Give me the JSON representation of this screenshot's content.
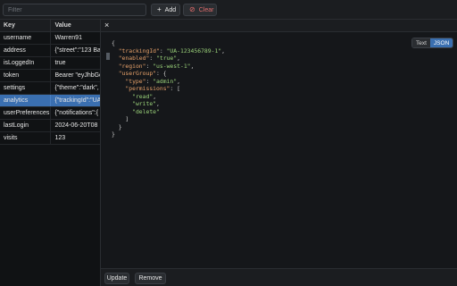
{
  "toolbar": {
    "filter_placeholder": "Filter",
    "add_label": "Add",
    "add_icon": "plus-icon",
    "clear_label": "Clear",
    "clear_icon": "ban-icon"
  },
  "table": {
    "headers": {
      "key": "Key",
      "value": "Value"
    },
    "rows": [
      {
        "key": "username",
        "value": "Warren91"
      },
      {
        "key": "address",
        "value": "{\"street\":\"123 Ba"
      },
      {
        "key": "isLoggedIn",
        "value": "true"
      },
      {
        "key": "token",
        "value": "Bearer \"eyJhbGc"
      },
      {
        "key": "settings",
        "value": "{\"theme\":\"dark\","
      },
      {
        "key": "analytics",
        "value": "{\"trackingId\":\"UA"
      },
      {
        "key": "userPreferences",
        "value": "{\"notifications\":{"
      },
      {
        "key": "lastLogin",
        "value": "2024-06-20T08"
      },
      {
        "key": "visits",
        "value": "123"
      }
    ],
    "selected_row": 5
  },
  "detail": {
    "close_icon": "close-icon",
    "view_modes": {
      "text": "Text",
      "json": "JSON",
      "active": "JSON"
    },
    "update_label": "Update",
    "remove_label": "Remove"
  },
  "json_lines": [
    [
      {
        "t": "p",
        "s": "{"
      }
    ],
    [
      {
        "t": "p",
        "s": "  "
      },
      {
        "t": "k",
        "s": "\"trackingId\""
      },
      {
        "t": "p",
        "s": ": "
      },
      {
        "t": "v",
        "s": "\"UA-123456789-1\""
      },
      {
        "t": "p",
        "s": ","
      }
    ],
    [
      {
        "t": "p",
        "s": "  "
      },
      {
        "t": "k",
        "s": "\"enabled\""
      },
      {
        "t": "p",
        "s": ": "
      },
      {
        "t": "v",
        "s": "\"true\""
      },
      {
        "t": "p",
        "s": ","
      }
    ],
    [
      {
        "t": "p",
        "s": "  "
      },
      {
        "t": "k",
        "s": "\"region\""
      },
      {
        "t": "p",
        "s": ": "
      },
      {
        "t": "v",
        "s": "\"us-west-1\""
      },
      {
        "t": "p",
        "s": ","
      }
    ],
    [
      {
        "t": "p",
        "s": "  "
      },
      {
        "t": "k",
        "s": "\"userGroup\""
      },
      {
        "t": "p",
        "s": ": {"
      }
    ],
    [
      {
        "t": "p",
        "s": "    "
      },
      {
        "t": "k",
        "s": "\"type\""
      },
      {
        "t": "p",
        "s": ": "
      },
      {
        "t": "v",
        "s": "\"admin\""
      },
      {
        "t": "p",
        "s": ","
      }
    ],
    [
      {
        "t": "p",
        "s": "    "
      },
      {
        "t": "k",
        "s": "\"permissions\""
      },
      {
        "t": "p",
        "s": ": ["
      }
    ],
    [
      {
        "t": "p",
        "s": "      "
      },
      {
        "t": "v",
        "s": "\"read\""
      },
      {
        "t": "p",
        "s": ","
      }
    ],
    [
      {
        "t": "p",
        "s": "      "
      },
      {
        "t": "v",
        "s": "\"write\""
      },
      {
        "t": "p",
        "s": ","
      }
    ],
    [
      {
        "t": "p",
        "s": "      "
      },
      {
        "t": "v",
        "s": "\"delete\""
      }
    ],
    [
      {
        "t": "p",
        "s": "    ]"
      }
    ],
    [
      {
        "t": "p",
        "s": "  }"
      }
    ],
    [
      {
        "t": "p",
        "s": "}"
      }
    ]
  ],
  "colors": {
    "accent": "#3a6fb0",
    "danger": "#e06c6c",
    "json_key": "#e8a26a",
    "json_string": "#9bd27a"
  }
}
